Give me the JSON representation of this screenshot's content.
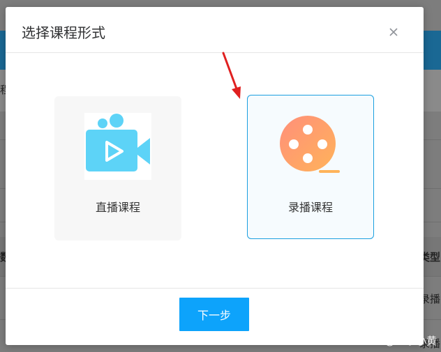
{
  "background": {
    "left_fragment": "程",
    "left_fragment2": "数",
    "right_head": "类型",
    "right_cell1": "录播",
    "right_cell2": "录播"
  },
  "dialog": {
    "title": "选择课程形式",
    "close_icon": "close-icon",
    "options": [
      {
        "label": "直播课程",
        "icon": "video-camera-icon",
        "selected": false
      },
      {
        "label": "录播课程",
        "icon": "film-reel-icon",
        "selected": true
      }
    ],
    "next_label": "下一步"
  },
  "annotation": {
    "arrow_color": "#e02020"
  },
  "colors": {
    "accent": "#0da3fb",
    "selected_border": "#1a9fe0",
    "live_icon": "#5dd3f7",
    "reel_icon": "#ffa26b"
  },
  "watermark": "CSDN @皇家小黄"
}
